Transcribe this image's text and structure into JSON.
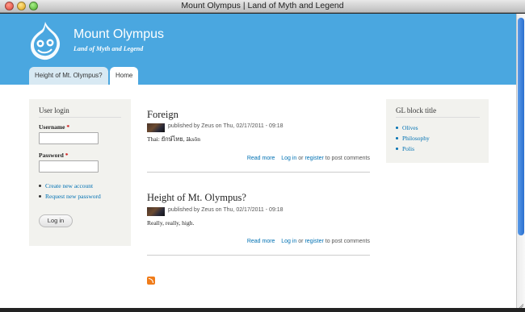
{
  "window": {
    "title": "Mount Olympus | Land of Myth and Legend"
  },
  "header": {
    "site_name": "Mount Olympus",
    "slogan": "Land of Myth and Legend",
    "tabs": [
      {
        "label": "Height of Mt. Olympus?"
      },
      {
        "label": "Home"
      }
    ]
  },
  "login": {
    "title": "User login",
    "username_label": "Username",
    "password_label": "Password",
    "required_mark": "*",
    "links": [
      "Create new account",
      "Request new password"
    ],
    "submit": "Log in"
  },
  "nodes": [
    {
      "title": "Foreign",
      "submitted": "published by Zeus on Thu, 02/17/2011 - 09:18",
      "body": "Thai: ยักษ์ไทย, ăksŏn",
      "read_more": "Read more",
      "log_in": "Log in",
      "or": "or",
      "register": "register",
      "to_post": "to post comments"
    },
    {
      "title": "Height of Mt. Olympus?",
      "submitted": "published by Zeus on Thu, 02/17/2011 - 09:18",
      "body": "Really, really, high.",
      "read_more": "Read more",
      "log_in": "Log in",
      "or": "or",
      "register": "register",
      "to_post": "to post comments"
    }
  ],
  "gl_block": {
    "title": "GL block title",
    "items": [
      "Olives",
      "Philosophy",
      "Polis"
    ]
  },
  "colors": {
    "header": "#4aa7e0",
    "link": "#0071b3",
    "sidebar_bg": "#f2f2ee"
  }
}
